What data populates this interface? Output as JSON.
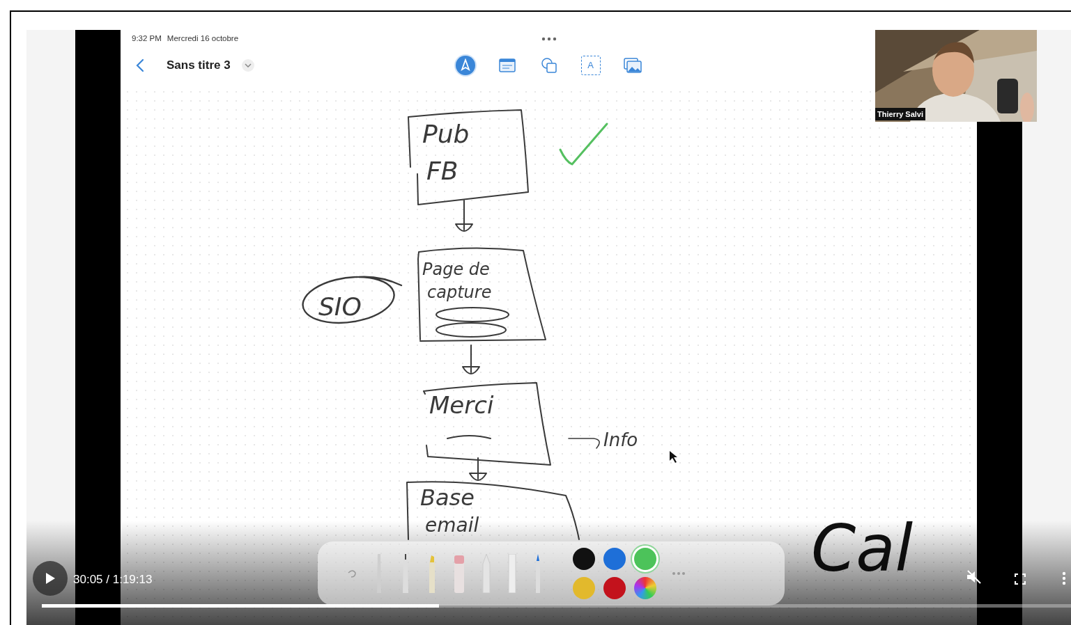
{
  "ipad": {
    "time": "9:32 PM",
    "date": "Mercredi 16 octobre",
    "title": "Sans titre 3",
    "tools": [
      {
        "kind": "pen",
        "selected": true
      },
      {
        "kind": "note",
        "selected": false
      },
      {
        "kind": "shapes",
        "selected": false
      },
      {
        "kind": "text",
        "label": "A",
        "selected": false
      },
      {
        "kind": "media",
        "selected": false
      }
    ]
  },
  "sketch": [
    {
      "kind": "box",
      "lines": [
        "Pub",
        "FB"
      ]
    },
    {
      "kind": "box",
      "lines": [
        "Page de",
        "capture"
      ]
    },
    {
      "kind": "bubble",
      "lines": [
        "SIO"
      ]
    },
    {
      "kind": "box",
      "lines": [
        "Merci"
      ]
    },
    {
      "kind": "pointer",
      "lines": [
        "Info"
      ]
    },
    {
      "kind": "box",
      "lines": [
        "Base",
        "email"
      ]
    },
    {
      "kind": "word",
      "lines": [
        "Cal"
      ]
    }
  ],
  "palette": [
    {
      "kind": "swatch",
      "color": "#111111",
      "selected": false
    },
    {
      "kind": "swatch",
      "color": "#1e6fd8",
      "selected": false
    },
    {
      "kind": "swatch",
      "color": "#4cc35a",
      "selected": true
    },
    {
      "kind": "swatch",
      "color": "#e2b92c",
      "selected": false
    },
    {
      "kind": "swatch",
      "color": "#c3121c",
      "selected": false
    },
    {
      "kind": "wheel",
      "selected": false
    }
  ],
  "webcam": {
    "name": "Thierry Salvi"
  },
  "player": {
    "time": "30:05 / 1:19:13",
    "playing": false,
    "muted": true,
    "progress": {
      "level": 0.386
    }
  }
}
